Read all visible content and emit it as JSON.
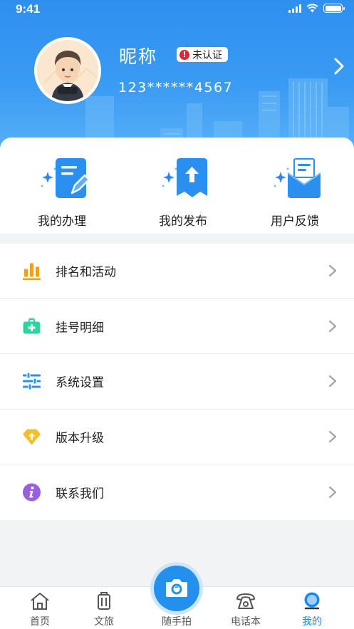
{
  "status_bar": {
    "time": "9:41"
  },
  "profile": {
    "nickname": "昵称",
    "badge": "未认证",
    "phone": "123******4567"
  },
  "quick_actions": [
    {
      "label": "我的办理",
      "icon": "document-edit-icon"
    },
    {
      "label": "我的发布",
      "icon": "upload-icon"
    },
    {
      "label": "用户反馈",
      "icon": "mail-icon"
    }
  ],
  "menu": [
    {
      "label": "排名和活动",
      "icon": "bar-chart-icon",
      "color": "#f0a020"
    },
    {
      "label": "挂号明细",
      "icon": "medical-kit-icon",
      "color": "#2ed59c"
    },
    {
      "label": "系统设置",
      "icon": "sliders-icon",
      "color": "#2b8ff0"
    },
    {
      "label": "版本升级",
      "icon": "upgrade-diamond-icon",
      "color": "#f3be2b"
    },
    {
      "label": "联系我们",
      "icon": "info-icon",
      "color": "#9a5fe0"
    }
  ],
  "tabbar": {
    "items": [
      {
        "label": "首页",
        "icon": "home-icon",
        "active": false
      },
      {
        "label": "文旅",
        "icon": "luggage-icon",
        "active": false
      },
      {
        "label": "随手拍",
        "icon": "camera-icon",
        "active": false
      },
      {
        "label": "电话本",
        "icon": "telephone-icon",
        "active": false
      },
      {
        "label": "我的",
        "icon": "profile-icon",
        "active": true
      }
    ]
  },
  "colors": {
    "header": "#3a9bf3",
    "accent": "#1a86f0",
    "background": "#f2f3f5"
  }
}
